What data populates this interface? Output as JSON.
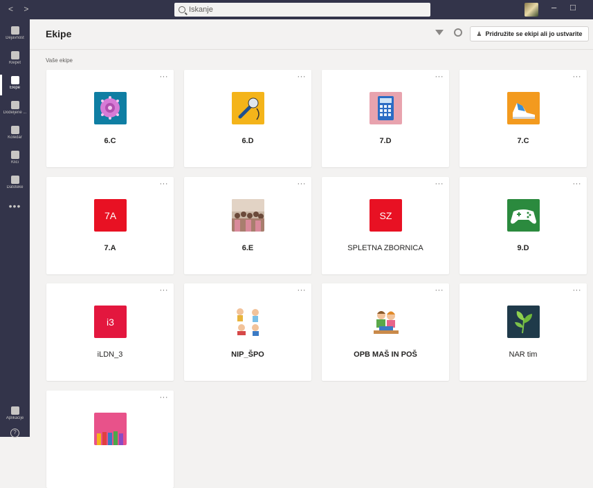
{
  "window": {
    "search_placeholder": "Iskanje"
  },
  "rail": {
    "items": [
      {
        "label": "Dejavnost",
        "icon": "bell-icon"
      },
      {
        "label": "Klepet",
        "icon": "chat-icon"
      },
      {
        "label": "Ekipe",
        "icon": "teams-icon",
        "active": true
      },
      {
        "label": "Dodeljene ...",
        "icon": "backpack-icon"
      },
      {
        "label": "Koledar",
        "icon": "calendar-icon"
      },
      {
        "label": "Klici",
        "icon": "phone-icon"
      },
      {
        "label": "Datoteke",
        "icon": "file-icon"
      }
    ],
    "more": "•••",
    "apps_label": "Aplikacije"
  },
  "header": {
    "title": "Ekipe",
    "join_button": "Pridružite se ekipi ali jo ustvarite"
  },
  "section_label": "Vaše ekipe",
  "teams": [
    {
      "name": "6.C",
      "tile": "image",
      "icon": "virus-image-icon",
      "bold": true
    },
    {
      "name": "6.D",
      "tile": "image",
      "icon": "microphone-image-icon",
      "bold": true
    },
    {
      "name": "7.D",
      "tile": "image",
      "icon": "calculator-image-icon",
      "bold": true
    },
    {
      "name": "7.C",
      "tile": "image",
      "icon": "sneaker-image-icon",
      "bold": true
    },
    {
      "name": "7.A",
      "tile": "initials",
      "initials": "7A",
      "color": "#e81123",
      "bold": true
    },
    {
      "name": "6.E",
      "tile": "image",
      "icon": "group-photo-icon",
      "bold": true
    },
    {
      "name": "SPLETNA ZBORNICA",
      "tile": "initials",
      "initials": "SZ",
      "color": "#e81123",
      "bold": false
    },
    {
      "name": "9.D",
      "tile": "image",
      "icon": "gamepad-image-icon",
      "bold": true
    },
    {
      "name": "iLDN_3",
      "tile": "initials",
      "initials": "i3",
      "color": "#e3173e",
      "bold": false
    },
    {
      "name": "NIP_ŠPO",
      "tile": "image",
      "icon": "kids-playing-icon",
      "bold": true
    },
    {
      "name": "OPB MAŠ IN POŠ",
      "tile": "image",
      "icon": "kids-reading-icon",
      "bold": true
    },
    {
      "name": "NAR tim",
      "tile": "image",
      "icon": "leaf-image-icon",
      "bold": false
    },
    {
      "name": "",
      "tile": "image",
      "icon": "pencils-image-icon",
      "bold": false
    }
  ],
  "more_label": "···"
}
